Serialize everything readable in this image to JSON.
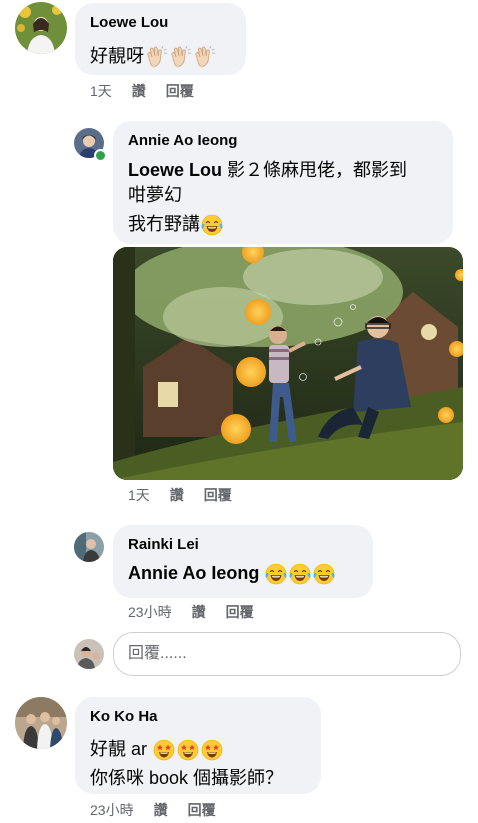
{
  "comments": [
    {
      "author": "Loewe Lou",
      "text": "好靚呀",
      "emoji": [
        "clapping-hands-icon",
        "clapping-hands-icon",
        "clapping-hands-icon"
      ],
      "time": "1天",
      "like_label": "讚",
      "reply_label": "回覆"
    },
    {
      "author": "Annie Ao Ieong",
      "mention": "Loewe Lou",
      "text_line1": " 影２條麻甩佬，都影到",
      "text_line2": "咁夢幻",
      "text_line3": "我冇野講",
      "emoji": [
        "tears-of-joy-icon"
      ],
      "time": "1天",
      "like_label": "讚",
      "reply_label": "回覆"
    },
    {
      "author": "Rainki Lei",
      "mention": "Annie Ao Ieong",
      "emoji": [
        "tears-of-joy-icon",
        "tears-of-joy-icon",
        "tears-of-joy-icon"
      ],
      "time": "23小時",
      "like_label": "讚",
      "reply_label": "回覆"
    },
    {
      "author": "Ko Ko Ha",
      "text_line1": "好靚 ar",
      "text_line2": "你係咪 book 個攝影師？",
      "emoji": [
        "star-struck-icon",
        "star-struck-icon",
        "star-struck-icon"
      ],
      "time": "23小時",
      "like_label": "讚",
      "reply_label": "回覆"
    }
  ],
  "reply_input": {
    "placeholder": "回覆......"
  },
  "colors": {
    "bubble": "#f0f2f5",
    "meta": "#65676b",
    "online": "#31a24c"
  }
}
